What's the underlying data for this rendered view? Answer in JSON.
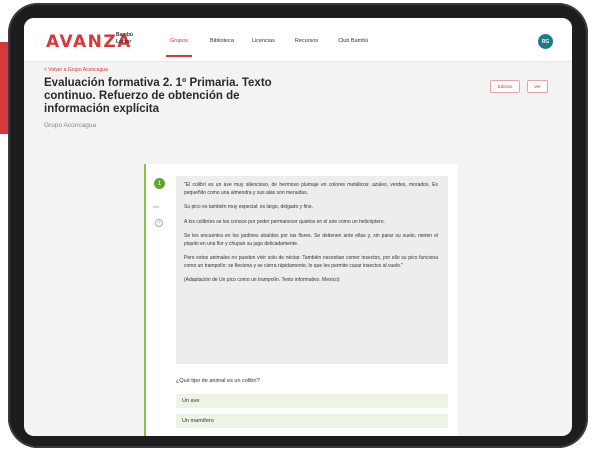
{
  "colors": {
    "brand": "#d8383a",
    "accent_green": "#63a335",
    "avatar_bg": "#1e7a86"
  },
  "header": {
    "logo": "AVANZA",
    "logo_sub": "Bambú Lector",
    "nav": [
      {
        "label": "Grupos",
        "active": true
      },
      {
        "label": "Biblioteca",
        "active": false
      },
      {
        "label": "Licencias",
        "active": false
      },
      {
        "label": "Recursos",
        "active": false
      },
      {
        "label": "Club Bambú",
        "active": false
      }
    ],
    "avatar_initials": "RG"
  },
  "page": {
    "back_link": "< Volver a Grupo Aconcagua",
    "title": "Evaluación formativa 2. 1º Primaria. Texto continuo. Refuerzo de obtención de información explícita",
    "group": "Grupo Aconcagua",
    "edit_button": "Edición",
    "view_button": "Ver"
  },
  "side": {
    "number": "1",
    "label": "info",
    "icon": "info-icon"
  },
  "reading_text": [
    "\"El colibrí es un ave muy silencioso, de hermoso plumaje en colores metálicos: azules, verdes, morados. Es pequeñito como una almendra y sus alas son menudas.",
    "Su pico es también muy especial: es largo, delgado y fino.",
    "A los colibríes se les conoce por poder permanecer quietos en el aire como un helicóptero.",
    "Se les encuentra en los jardines atraídos por las flores. Se detienen ante ellas y, sin parar su vuelo, meten el piquito en una flor y chupan su jugo delicadamente.",
    "Pero estos animales no pueden vivir solo de néctar. También necesitan comer insectos, por ello su pico funciona como un trampolín: se flexiona y se cierra rápidamente, lo que les permite cazar insectos al vuelo.\"",
    "(Adaptación de Un pico como un trampolín. Texto informativo. Mexico)"
  ],
  "question": {
    "prompt": "¿Qué tipo de animal es un colibrí?",
    "options": [
      "Un ave",
      "Un mamífero"
    ]
  }
}
